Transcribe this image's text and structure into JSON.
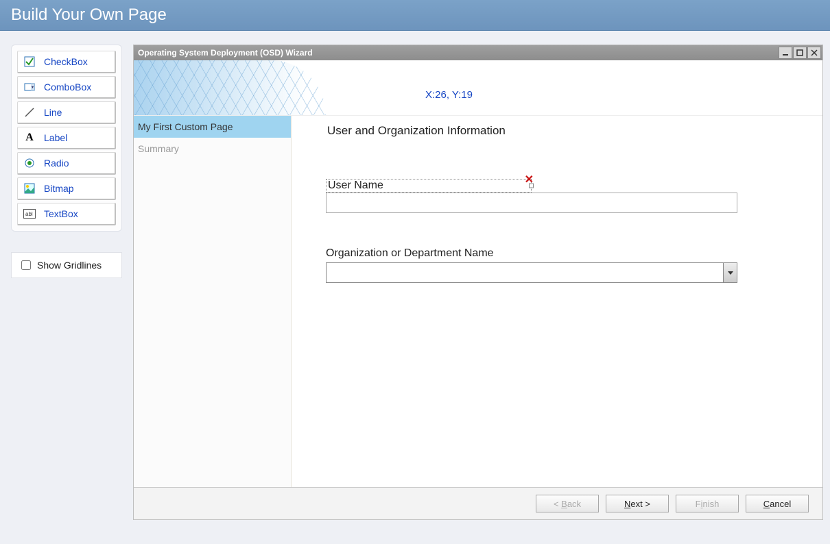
{
  "header": {
    "title": "Build Your Own Page"
  },
  "toolbox": {
    "items": [
      {
        "label": "CheckBox",
        "icon": "checkbox-icon"
      },
      {
        "label": "ComboBox",
        "icon": "combobox-icon"
      },
      {
        "label": "Line",
        "icon": "line-icon"
      },
      {
        "label": "Label",
        "icon": "label-icon"
      },
      {
        "label": "Radio",
        "icon": "radio-icon"
      },
      {
        "label": "Bitmap",
        "icon": "bitmap-icon"
      },
      {
        "label": "TextBox",
        "icon": "textbox-icon"
      }
    ]
  },
  "gridlines": {
    "label": "Show Gridlines",
    "checked": false
  },
  "wizard": {
    "title": "Operating System Deployment (OSD) Wizard",
    "coord": "X:26, Y:19",
    "steps": [
      {
        "label": "My First Custom Page",
        "active": true
      },
      {
        "label": "Summary",
        "active": false
      }
    ],
    "form": {
      "heading": "User and Organization Information",
      "username_label": "User Name",
      "username_value": "",
      "org_label": "Organization or Department Name",
      "org_value": ""
    },
    "buttons": {
      "back": "< Back",
      "next": "Next >",
      "finish": "Finish",
      "cancel": "Cancel"
    }
  }
}
